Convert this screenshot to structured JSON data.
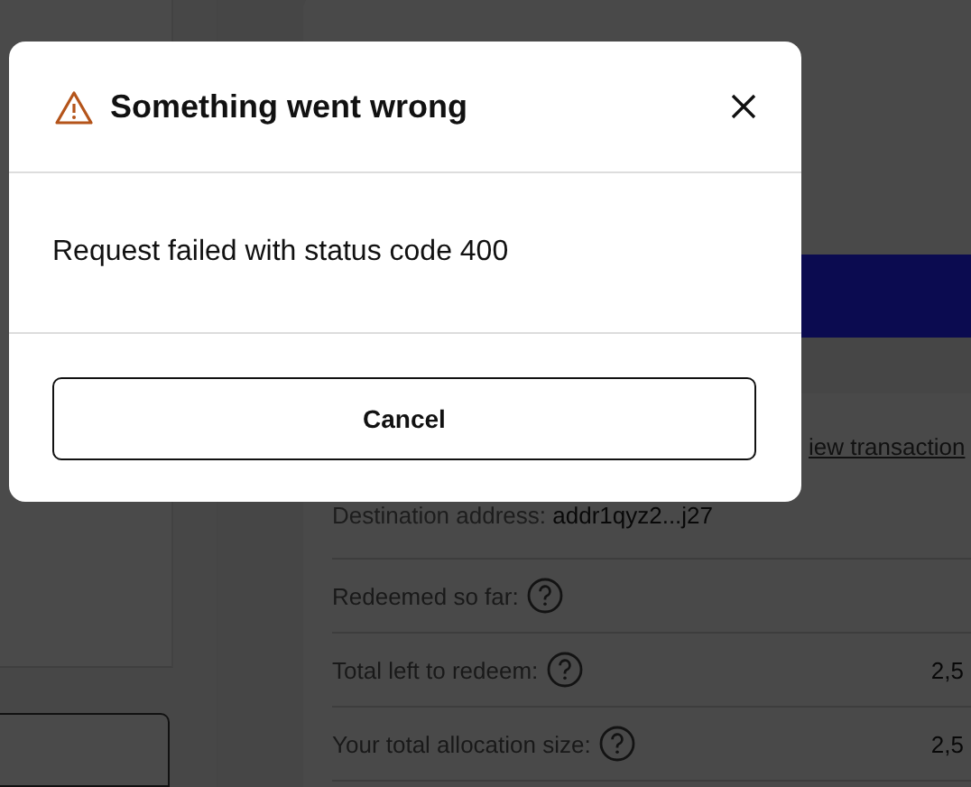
{
  "dialog": {
    "title": "Something went wrong",
    "message": "Request failed with status code 400",
    "buttons": [
      "Cancel"
    ]
  },
  "background": {
    "transaction_link": "iew transaction",
    "destination": {
      "label": "Destination address:",
      "value": "addr1qyz2...j27"
    },
    "rows": [
      {
        "label": "Redeemed so far:"
      },
      {
        "label": "Total left to redeem:",
        "value": "2,5"
      },
      {
        "label": "Your total allocation size:",
        "value": "2,5"
      }
    ]
  }
}
